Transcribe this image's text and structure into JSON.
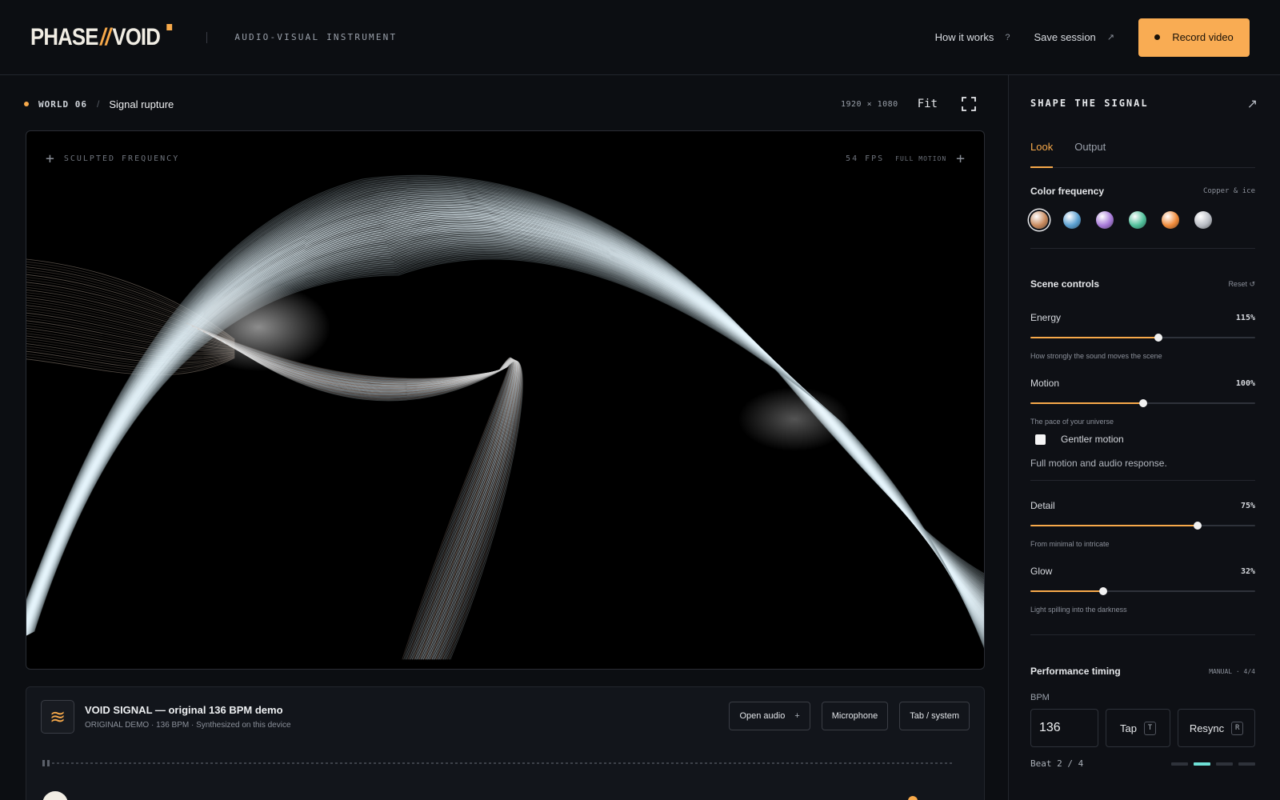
{
  "header": {
    "logo_left": "PHASE",
    "logo_slash": "//",
    "logo_right": "VOID",
    "tagline": "AUDIO-VISUAL INSTRUMENT",
    "how_it_works": "How it works",
    "how_icon": "?",
    "save_session": "Save session",
    "save_icon": "↗",
    "record": "Record video",
    "accent": "#f9ac53"
  },
  "breadcrumb": {
    "world": "WORLD 06",
    "sep": "/",
    "name": "Signal rupture"
  },
  "viewtools": {
    "resolution": "1920 × 1080",
    "fit": "Fit"
  },
  "viewport": {
    "label_left": "SCULPTED FREQUENCY",
    "fps": "54 FPS",
    "motion": "FULL MOTION"
  },
  "player": {
    "title": "VOID SIGNAL — original 136 BPM demo",
    "subtitle": "ORIGINAL DEMO · 136 BPM · Synthesized on this device",
    "open_audio": "Open audio",
    "open_audio_icon": "+",
    "microphone": "Microphone",
    "tab_system": "Tab / system"
  },
  "panel": {
    "title": "SHAPE THE SIGNAL",
    "tabs": [
      {
        "label": "Look"
      },
      {
        "label": "Output"
      }
    ],
    "color": {
      "heading": "Color frequency",
      "selected_name": "Copper & ice",
      "swatches": [
        "#c88a5e",
        "#5a9fd0",
        "#a77ad8",
        "#4fbf9a",
        "#ef8a3a",
        "#b9bdc4"
      ]
    },
    "scene": {
      "heading": "Scene controls",
      "reset": "Reset ↺",
      "sliders": [
        {
          "label": "Energy",
          "value_text": "115%",
          "fraction": 0.57,
          "hint": "How strongly the sound moves the scene"
        },
        {
          "label": "Motion",
          "value_text": "100%",
          "fraction": 0.5,
          "hint": "The pace of your universe"
        },
        {
          "label": "Detail",
          "value_text": "75%",
          "fraction": 0.745,
          "hint": "From minimal to intricate"
        },
        {
          "label": "Glow",
          "value_text": "32%",
          "fraction": 0.325,
          "hint": "Light spilling into the darkness"
        }
      ],
      "gentler_motion": "Gentler motion",
      "motion_note": "Full motion and audio response."
    },
    "timing": {
      "heading": "Performance timing",
      "meta": "MANUAL · 4/4",
      "bpm_label": "BPM",
      "bpm_value": "136",
      "tap": "Tap",
      "tap_key": "T",
      "resync": "Resync",
      "resync_key": "R",
      "beat_text": "Beat 2 / 4",
      "beat_count": 4,
      "current_beat": 2
    }
  }
}
